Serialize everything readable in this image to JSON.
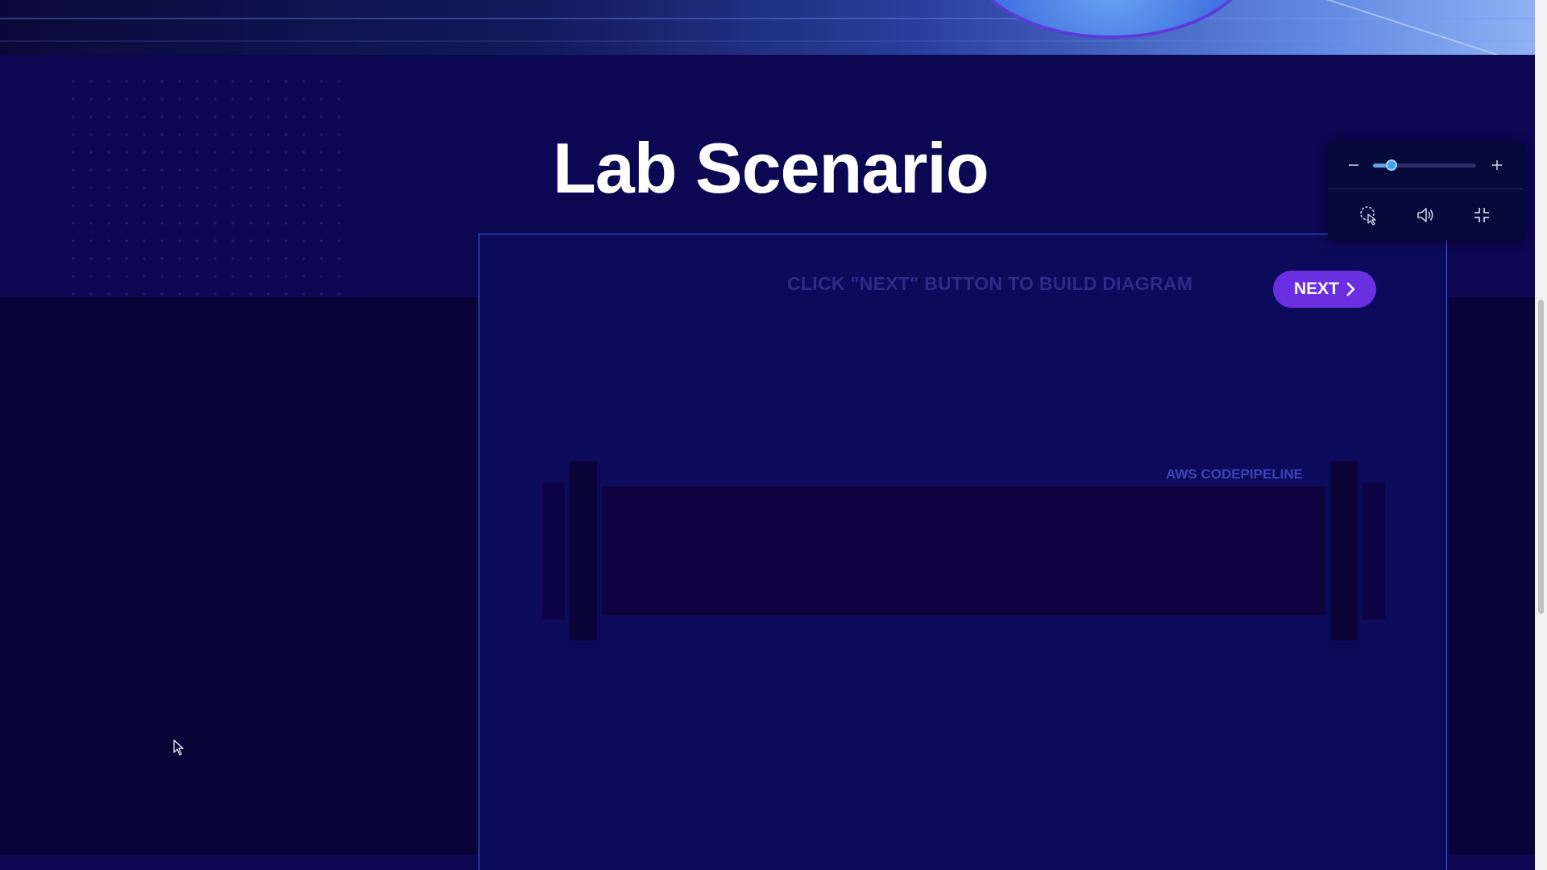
{
  "page": {
    "title": "Lab Scenario"
  },
  "diagram": {
    "instruction": "CLICK \"NEXT\" BUTTON TO BUILD DIAGRAM",
    "next_button": {
      "label": "NEXT",
      "icon": "chevron-right-icon"
    },
    "pipeline_label": "AWS CODEPIPELINE"
  },
  "media_controls": {
    "zoom_out_icon": "minus-icon",
    "zoom_in_icon": "plus-icon",
    "zoom_level": 0.18,
    "buttons": [
      {
        "icon": "cursor-highlight-icon"
      },
      {
        "icon": "volume-icon"
      },
      {
        "icon": "exit-fullscreen-icon"
      }
    ]
  },
  "scroll": {
    "position_fraction": 0.35
  },
  "colors": {
    "background": "#0b0752",
    "panel_border": "#3d62e8",
    "accent_button": "#6a2fe0",
    "title_text": "#ffffff",
    "instruction_text": "#2c2c86",
    "pipeline_label_text": "#3e44b8"
  }
}
